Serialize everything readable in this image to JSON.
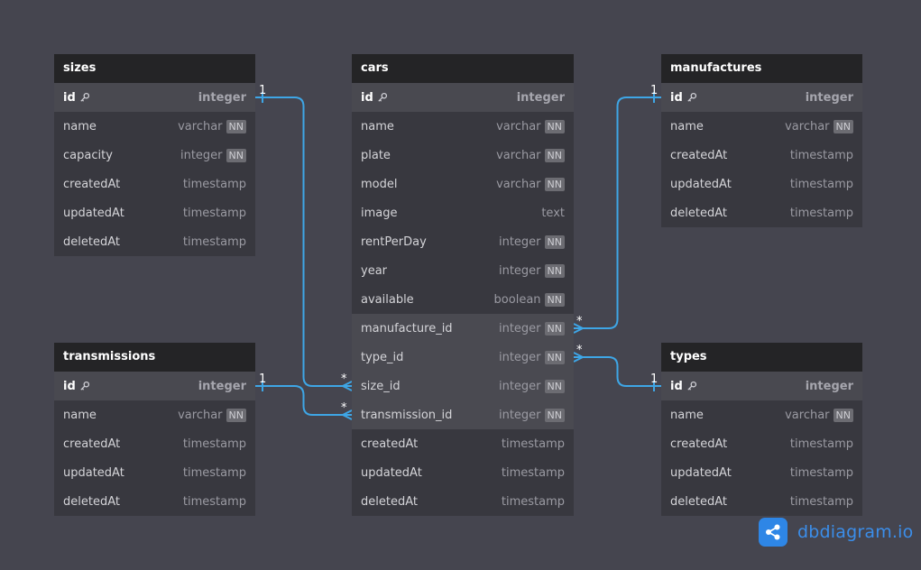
{
  "tables": [
    {
      "id": "sizes",
      "name": "sizes",
      "columns": [
        {
          "name": "id",
          "type": "integer",
          "pk": true
        },
        {
          "name": "name",
          "type": "varchar",
          "nn": true
        },
        {
          "name": "capacity",
          "type": "integer",
          "nn": true
        },
        {
          "name": "createdAt",
          "type": "timestamp"
        },
        {
          "name": "updatedAt",
          "type": "timestamp"
        },
        {
          "name": "deletedAt",
          "type": "timestamp"
        }
      ]
    },
    {
      "id": "cars",
      "name": "cars",
      "columns": [
        {
          "name": "id",
          "type": "integer",
          "pk": true
        },
        {
          "name": "name",
          "type": "varchar",
          "nn": true
        },
        {
          "name": "plate",
          "type": "varchar",
          "nn": true
        },
        {
          "name": "model",
          "type": "varchar",
          "nn": true
        },
        {
          "name": "image",
          "type": "text"
        },
        {
          "name": "rentPerDay",
          "type": "integer",
          "nn": true
        },
        {
          "name": "year",
          "type": "integer",
          "nn": true
        },
        {
          "name": "available",
          "type": "boolean",
          "nn": true
        },
        {
          "name": "manufacture_id",
          "type": "integer",
          "nn": true,
          "fk": true
        },
        {
          "name": "type_id",
          "type": "integer",
          "nn": true,
          "fk": true
        },
        {
          "name": "size_id",
          "type": "integer",
          "nn": true,
          "fk": true
        },
        {
          "name": "transmission_id",
          "type": "integer",
          "nn": true,
          "fk": true
        },
        {
          "name": "createdAt",
          "type": "timestamp"
        },
        {
          "name": "updatedAt",
          "type": "timestamp"
        },
        {
          "name": "deletedAt",
          "type": "timestamp"
        }
      ]
    },
    {
      "id": "manufactures",
      "name": "manufactures",
      "columns": [
        {
          "name": "id",
          "type": "integer",
          "pk": true
        },
        {
          "name": "name",
          "type": "varchar",
          "nn": true
        },
        {
          "name": "createdAt",
          "type": "timestamp"
        },
        {
          "name": "updatedAt",
          "type": "timestamp"
        },
        {
          "name": "deletedAt",
          "type": "timestamp"
        }
      ]
    },
    {
      "id": "transmissions",
      "name": "transmissions",
      "columns": [
        {
          "name": "id",
          "type": "integer",
          "pk": true
        },
        {
          "name": "name",
          "type": "varchar",
          "nn": true
        },
        {
          "name": "createdAt",
          "type": "timestamp"
        },
        {
          "name": "updatedAt",
          "type": "timestamp"
        },
        {
          "name": "deletedAt",
          "type": "timestamp"
        }
      ]
    },
    {
      "id": "types",
      "name": "types",
      "columns": [
        {
          "name": "id",
          "type": "integer",
          "pk": true
        },
        {
          "name": "name",
          "type": "varchar",
          "nn": true
        },
        {
          "name": "createdAt",
          "type": "timestamp"
        },
        {
          "name": "updatedAt",
          "type": "timestamp"
        },
        {
          "name": "deletedAt",
          "type": "timestamp"
        }
      ]
    }
  ],
  "not_null_label": "NN",
  "relations": [
    {
      "from_table": "sizes",
      "from_column": "id",
      "from_card": "1",
      "to_table": "cars",
      "to_column": "size_id",
      "to_card": "*"
    },
    {
      "from_table": "transmissions",
      "from_column": "id",
      "from_card": "1",
      "to_table": "cars",
      "to_column": "transmission_id",
      "to_card": "*"
    },
    {
      "from_table": "manufactures",
      "from_column": "id",
      "from_card": "1",
      "to_table": "cars",
      "to_column": "manufacture_id",
      "to_card": "*"
    },
    {
      "from_table": "types",
      "from_column": "id",
      "from_card": "1",
      "to_table": "cars",
      "to_column": "type_id",
      "to_card": "*"
    }
  ],
  "brand": {
    "name": "dbdiagram.io",
    "icon": "share-icon",
    "color": "#2e86e6"
  },
  "colors": {
    "edge": "#3ea6e6",
    "background": "#45454f",
    "header": "#242426"
  }
}
